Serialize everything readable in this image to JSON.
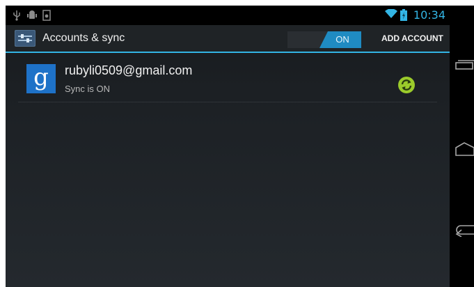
{
  "status_bar": {
    "time": "10:34",
    "left_icons": [
      "usb-icon",
      "android-debug-icon",
      "screenshot-icon"
    ],
    "right_icons": [
      "wifi-icon",
      "battery-icon"
    ],
    "accent_color": "#33b5e5"
  },
  "action_bar": {
    "title": "Accounts & sync",
    "sync_toggle_label": "ON",
    "add_account_label": "ADD ACCOUNT"
  },
  "accounts": [
    {
      "email": "rubyli0509@gmail.com",
      "status": "Sync is ON",
      "provider_icon": "google-icon",
      "sync_state_icon": "sync-icon"
    }
  ],
  "nav_bar": {
    "buttons": [
      "recent-apps-icon",
      "home-icon",
      "back-icon"
    ]
  },
  "colors": {
    "accent": "#33b5e5",
    "toggle_on": "#1f8bc2",
    "google_blue": "#1e72c8",
    "sync_green": "#9bcb2b"
  }
}
